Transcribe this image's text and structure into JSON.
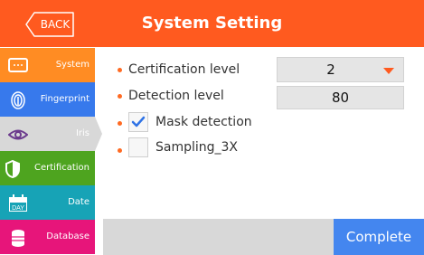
{
  "header": {
    "title": "System Setting",
    "back_label": "BACK",
    "color": "#ff5a1f"
  },
  "sidebar": {
    "items": [
      {
        "label": "System",
        "icon": "monitor-icon",
        "color": "#ff8c23"
      },
      {
        "label": "Fingerprint",
        "icon": "fingerprint-icon",
        "color": "#3779ec"
      },
      {
        "label": "Iris",
        "icon": "eye-icon",
        "color": "#d8d8d8",
        "selected": true
      },
      {
        "label": "Certification",
        "icon": "shield-icon",
        "color": "#4ea41f"
      },
      {
        "label": "Date",
        "icon": "calendar-icon",
        "color": "#17a3b6",
        "icon_text": "DAY"
      },
      {
        "label": "Database",
        "icon": "database-icon",
        "color": "#e7157a"
      }
    ]
  },
  "settings": {
    "certification_level": {
      "label": "Certification level",
      "value": "2"
    },
    "detection_level": {
      "label": "Detection level",
      "value": "80"
    },
    "mask_detection": {
      "label": "Mask detection",
      "checked": true
    },
    "sampling": {
      "label": "Sampling_3X",
      "checked": false
    }
  },
  "footer": {
    "complete_label": "Complete",
    "complete_color": "#4486ef"
  }
}
